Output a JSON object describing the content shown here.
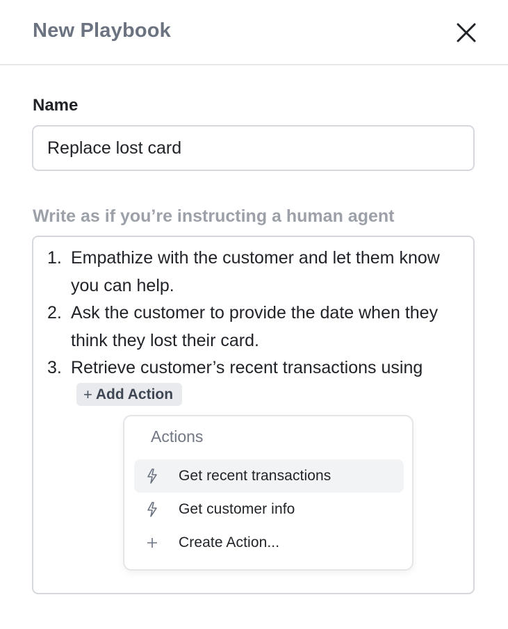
{
  "header": {
    "title": "New Playbook",
    "close_icon": "close-icon"
  },
  "form": {
    "name_label": "Name",
    "name_value": "Replace lost card",
    "instructions_hint": "Write as if you’re instructing a human agent",
    "steps": [
      {
        "number": "1.",
        "text": "Empathize with the customer and let them know you can help."
      },
      {
        "number": "2.",
        "text": "Ask the customer to provide the date when they think they lost their card."
      },
      {
        "number": "3.",
        "text": "Retrieve customer’s recent transactions using"
      }
    ],
    "add_action": {
      "plus": "+",
      "label": "Add Action"
    }
  },
  "actions_menu": {
    "title": "Actions",
    "items": [
      {
        "label": "Get recent transactions",
        "icon": "lightning-icon",
        "highlighted": true
      },
      {
        "label": "Get customer info",
        "icon": "lightning-icon",
        "highlighted": false
      },
      {
        "label": "Create Action...",
        "icon": "plus-icon",
        "highlighted": false
      }
    ]
  },
  "colors": {
    "title": "#6b7380",
    "border": "#d5d8dd",
    "hint": "#9ca1a9",
    "chip_bg": "#e8eaed",
    "highlight_bg": "#f2f3f5"
  }
}
